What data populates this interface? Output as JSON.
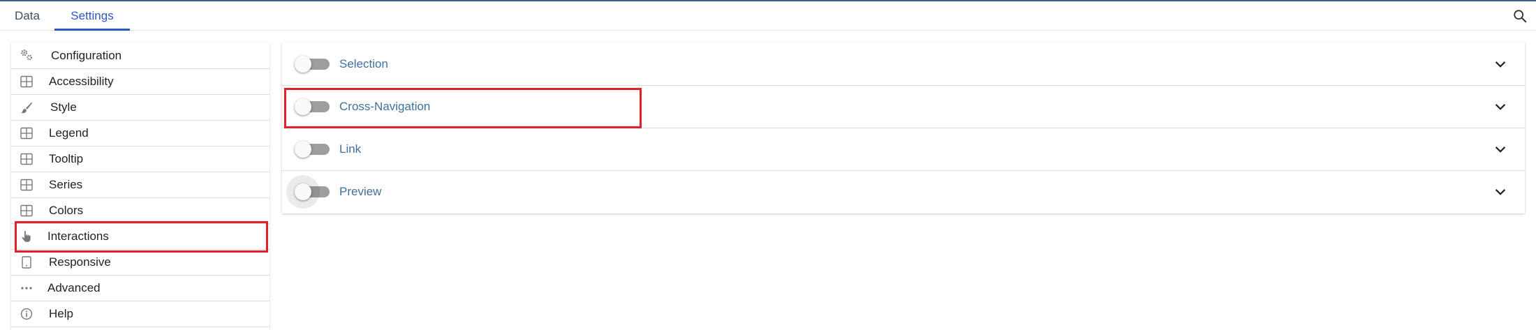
{
  "tabs": [
    {
      "label": "Data"
    },
    {
      "label": "Settings",
      "active": true
    }
  ],
  "sidebar": {
    "items": [
      {
        "label": "Configuration",
        "icon": "gears-icon"
      },
      {
        "label": "Accessibility",
        "icon": "table-icon"
      },
      {
        "label": "Style",
        "icon": "brush-icon"
      },
      {
        "label": "Legend",
        "icon": "table-icon"
      },
      {
        "label": "Tooltip",
        "icon": "table-icon"
      },
      {
        "label": "Series",
        "icon": "table-icon"
      },
      {
        "label": "Colors",
        "icon": "table-icon"
      },
      {
        "label": "Interactions",
        "icon": "hand-pointer-icon",
        "highlighted": true
      },
      {
        "label": "Responsive",
        "icon": "tablet-icon"
      },
      {
        "label": "Advanced",
        "icon": "ellipsis-icon"
      },
      {
        "label": "Help",
        "icon": "info-icon"
      }
    ]
  },
  "panels": [
    {
      "label": "Selection",
      "enabled": false
    },
    {
      "label": "Cross-Navigation",
      "enabled": false,
      "highlighted": true
    },
    {
      "label": "Link",
      "enabled": false
    },
    {
      "label": "Preview",
      "enabled": false,
      "focused": true
    }
  ],
  "colors": {
    "accent": "#2f56c9",
    "panel_label": "#3f6fa0",
    "highlight_box": "#e0202a",
    "toggle_track": "#9e9e9e"
  }
}
